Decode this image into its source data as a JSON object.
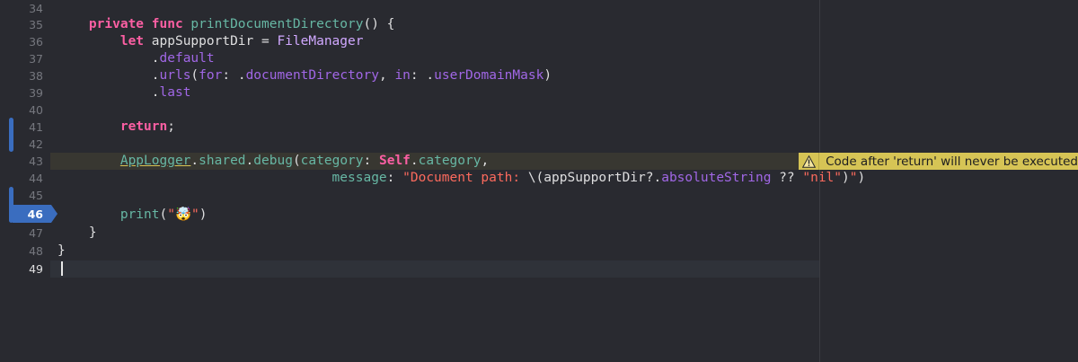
{
  "editor": {
    "lines": [
      {
        "num": "34",
        "tokens": []
      },
      {
        "num": "35",
        "tokens": [
          {
            "t": "    "
          },
          {
            "t": "private",
            "c": "kw"
          },
          {
            "t": " "
          },
          {
            "t": "func",
            "c": "kw"
          },
          {
            "t": " "
          },
          {
            "t": "printDocumentDirectory",
            "c": "fn"
          },
          {
            "t": "() {"
          }
        ]
      },
      {
        "num": "36",
        "tokens": [
          {
            "t": "        "
          },
          {
            "t": "let",
            "c": "kw"
          },
          {
            "t": " appSupportDir = "
          },
          {
            "t": "FileManager",
            "c": "ty"
          }
        ]
      },
      {
        "num": "37",
        "tokens": [
          {
            "t": "            ."
          },
          {
            "t": "default",
            "c": "prop"
          }
        ]
      },
      {
        "num": "38",
        "tokens": [
          {
            "t": "            ."
          },
          {
            "t": "urls",
            "c": "prop"
          },
          {
            "t": "("
          },
          {
            "t": "for",
            "c": "prop"
          },
          {
            "t": ": ."
          },
          {
            "t": "documentDirectory",
            "c": "prop"
          },
          {
            "t": ", "
          },
          {
            "t": "in",
            "c": "prop"
          },
          {
            "t": ": ."
          },
          {
            "t": "userDomainMask",
            "c": "prop"
          },
          {
            "t": ")"
          }
        ]
      },
      {
        "num": "39",
        "tokens": [
          {
            "t": "            ."
          },
          {
            "t": "last",
            "c": "prop"
          }
        ]
      },
      {
        "num": "40",
        "tokens": []
      },
      {
        "num": "41",
        "tokens": [
          {
            "t": "        "
          },
          {
            "t": "return",
            "c": "kw"
          },
          {
            "t": ";"
          }
        ]
      },
      {
        "num": "42",
        "tokens": []
      },
      {
        "num": "43",
        "tokens": [
          {
            "t": "        "
          },
          {
            "t": "AppLogger",
            "c": "tyu"
          },
          {
            "t": "."
          },
          {
            "t": "shared",
            "c": "fn"
          },
          {
            "t": "."
          },
          {
            "t": "debug",
            "c": "fn"
          },
          {
            "t": "("
          },
          {
            "t": "category",
            "c": "fn"
          },
          {
            "t": ": "
          },
          {
            "t": "Self",
            "c": "kw"
          },
          {
            "t": "."
          },
          {
            "t": "category",
            "c": "fn"
          },
          {
            "t": ","
          }
        ]
      },
      {
        "num": "44",
        "tokens": [
          {
            "t": "                                   "
          },
          {
            "t": "message",
            "c": "fn"
          },
          {
            "t": ": "
          },
          {
            "t": "\"Document path: ",
            "c": "str"
          },
          {
            "t": "\\(appSupportDir?."
          },
          {
            "t": "absoluteString",
            "c": "prop"
          },
          {
            "t": " ?? "
          },
          {
            "t": "\"nil\"",
            "c": "str"
          },
          {
            "t": ")"
          },
          {
            "t": "\"",
            "c": "str"
          },
          {
            "t": ")"
          }
        ]
      },
      {
        "num": "45",
        "tokens": []
      },
      {
        "num": "46",
        "tokens": [
          {
            "t": "        "
          },
          {
            "t": "print",
            "c": "fn"
          },
          {
            "t": "("
          },
          {
            "t": "\"🤯\"",
            "c": "str"
          },
          {
            "t": ")"
          }
        ]
      },
      {
        "num": "47",
        "tokens": [
          {
            "t": "    }"
          }
        ]
      },
      {
        "num": "48",
        "tokens": [
          {
            "t": "}"
          }
        ]
      },
      {
        "num": "49",
        "tokens": []
      }
    ],
    "breakpoint_line": "46",
    "current_line": "49"
  },
  "warning": {
    "icon": "warning-triangle-icon",
    "message": "Code after 'return' will never be executed"
  },
  "colors": {
    "background": "#292a30",
    "keyword": "#fc5fa3",
    "function": "#67b7a4",
    "type": "#d0a8ff",
    "property": "#a167e6",
    "string": "#fc6a5d",
    "warning": "#d6c455",
    "breakpoint": "#3a6dbf"
  }
}
